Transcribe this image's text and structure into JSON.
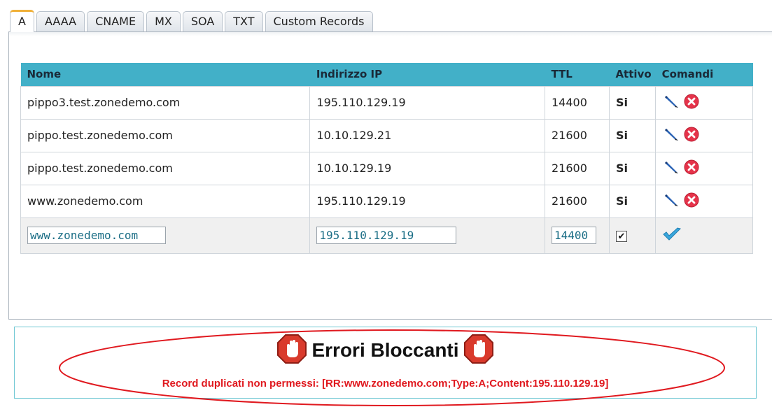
{
  "tabs": [
    "A",
    "AAAA",
    "CNAME",
    "MX",
    "SOA",
    "TXT",
    "Custom Records"
  ],
  "active_tab": "A",
  "table": {
    "headers": {
      "name": "Nome",
      "ip": "Indirizzo IP",
      "ttl": "TTL",
      "active": "Attivo",
      "commands": "Comandi"
    },
    "rows": [
      {
        "name": "pippo3.test.zonedemo.com",
        "ip": "195.110.129.19",
        "ttl": "14400",
        "active": "Si"
      },
      {
        "name": "pippo.test.zonedemo.com",
        "ip": "10.10.129.21",
        "ttl": "21600",
        "active": "Si"
      },
      {
        "name": "pippo.test.zonedemo.com",
        "ip": "10.10.129.19",
        "ttl": "21600",
        "active": "Si"
      },
      {
        "name": "www.zonedemo.com",
        "ip": "195.110.129.19",
        "ttl": "21600",
        "active": "Si"
      }
    ],
    "edit_row": {
      "name": "www.zonedemo.com",
      "ip": "195.110.129.19",
      "ttl": "14400",
      "active_checked": true
    }
  },
  "error": {
    "title": "Errori Bloccanti",
    "message": "Record duplicati non permessi: [RR:www.zonedemo.com;Type:A;Content:195.110.129.19]"
  },
  "colors": {
    "header_bg": "#42b0c8",
    "active_green": "#1e8a1e",
    "error_red": "#e0191f",
    "tab_accent": "#f0b13a"
  },
  "icons": {
    "edit": "pencil-icon",
    "delete": "delete-icon",
    "confirm": "checkmark-icon",
    "error": "stop-hand-icon"
  }
}
